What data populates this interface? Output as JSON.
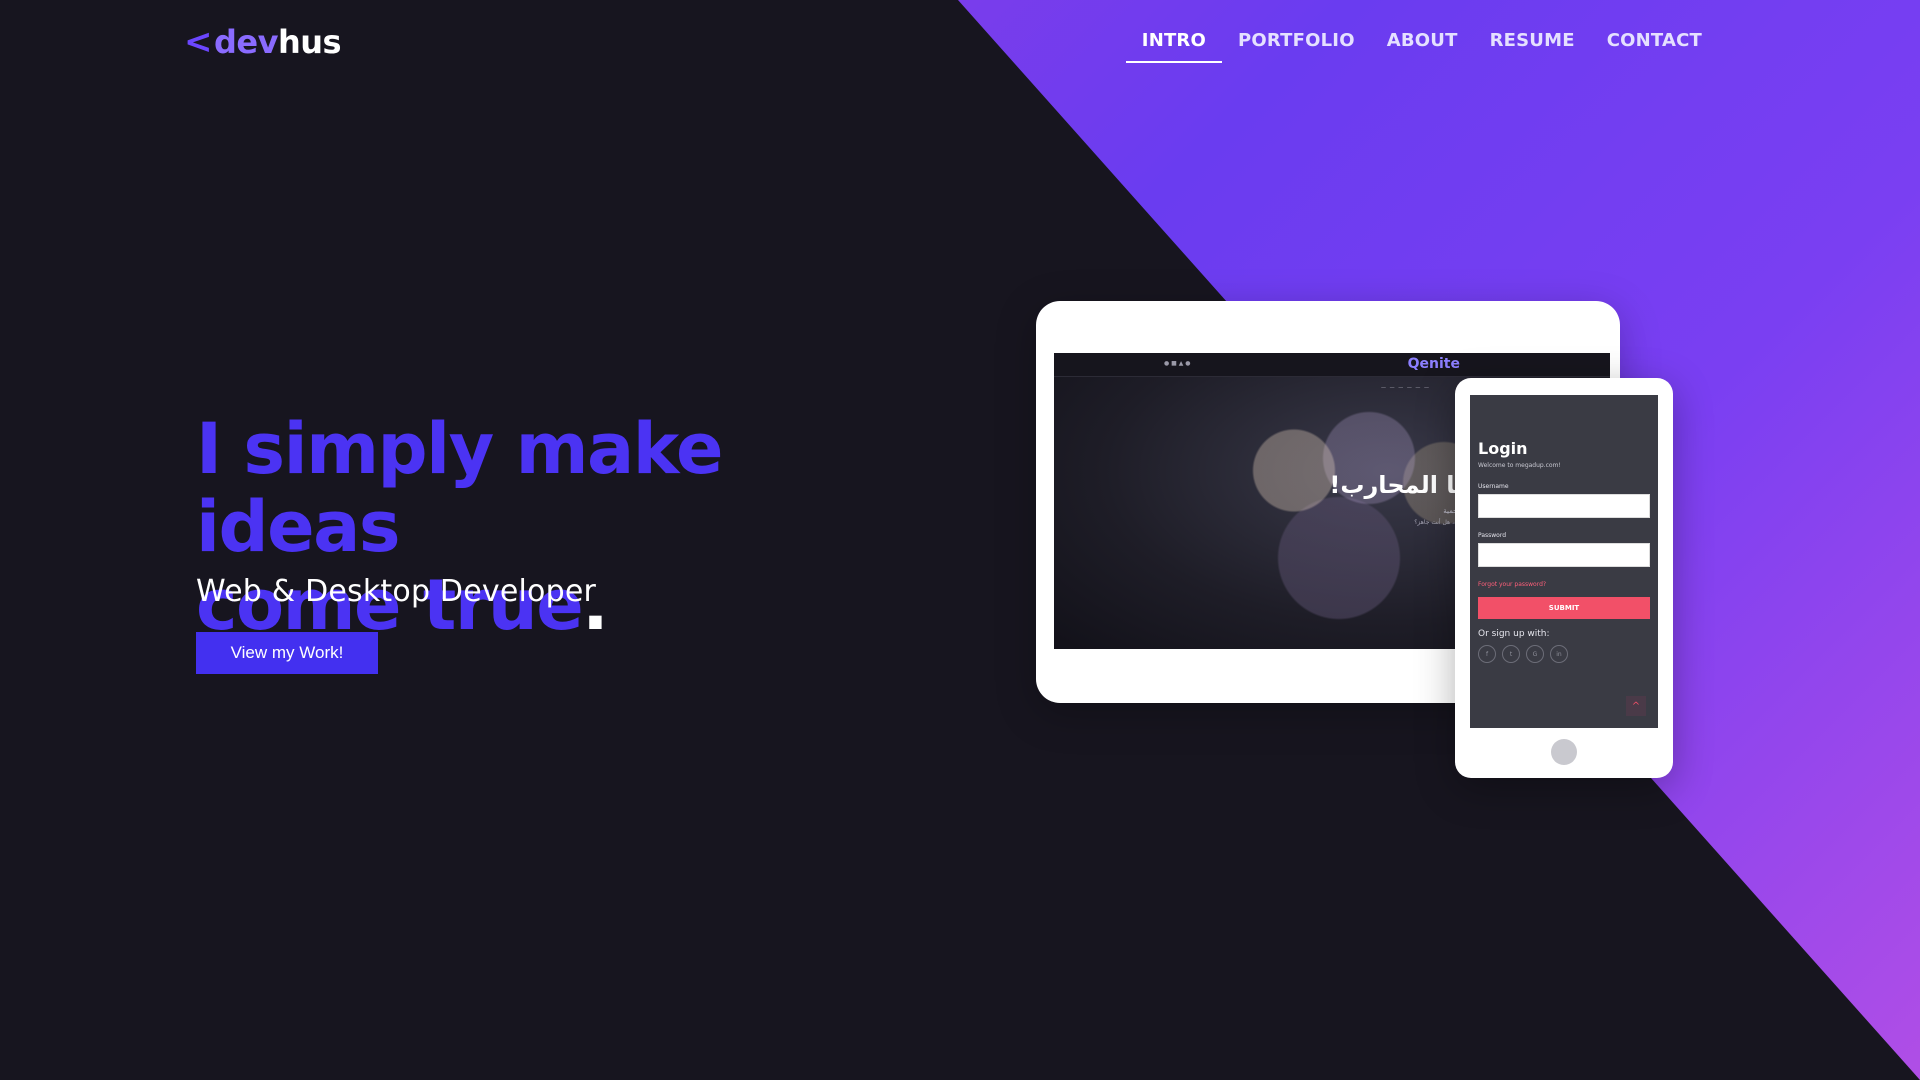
{
  "header": {
    "logo": {
      "chevron": "<",
      "part1": "dev",
      "part2": "hus"
    },
    "nav": [
      {
        "label": "INTRO",
        "active": true
      },
      {
        "label": "PORTFOLIO",
        "active": false
      },
      {
        "label": "ABOUT",
        "active": false
      },
      {
        "label": "RESUME",
        "active": false
      },
      {
        "label": "CONTACT",
        "active": false
      }
    ]
  },
  "hero": {
    "title_line1": "I simply make ideas",
    "title_line2": "come true",
    "title_dot": ".",
    "subtitle": "Web & Desktop Developer",
    "cta_label": "View my Work!"
  },
  "tablet_mockup": {
    "brand": "Qenite",
    "headline": "مرحباً... ايها المحارب!",
    "small1": "إنضم للمعركة الملحمية",
    "small2": "عصر جديد من الألعاب في انتظارك، هل أنت جاهز؟"
  },
  "phone_mockup": {
    "title": "Login",
    "welcome": "Welcome to megadup.com!",
    "username_label": "Username",
    "password_label": "Password",
    "forgot": "Forgot your password?",
    "submit": "SUBMIT",
    "or_signup": "Or sign up with:",
    "socials": [
      "f",
      "t",
      "G",
      "in"
    ],
    "up_icon": "^"
  },
  "colors": {
    "background": "#17151f",
    "accent": "#4b33f3",
    "band_start": "#a03fe0",
    "band_mid": "#6a3cf0",
    "cta": "#4330f0",
    "submit": "#f25068"
  }
}
